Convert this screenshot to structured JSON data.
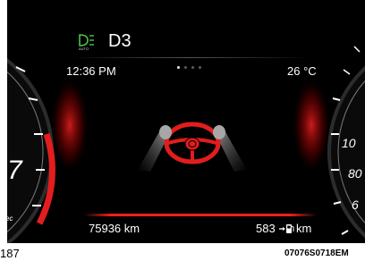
{
  "status": {
    "gear": "D3",
    "auto_label": "AUTO"
  },
  "info_bar": {
    "time": "12:36 PM",
    "outside_temp": "26 °C",
    "active_page_index": 0,
    "page_count": 4
  },
  "indicator": {
    "icon": "auto-headlight-icon",
    "color": "#4dc34d"
  },
  "center": {
    "icon": "steering-wheel-hands-icon",
    "wheel_color": "#e31d1d"
  },
  "trip": {
    "odometer": "75936 km",
    "range_value": "583",
    "range_unit": "km",
    "range_icon": "fuel-pump-icon"
  },
  "gauges": {
    "left_visible_number": "7",
    "right_visible_numbers": [
      "10",
      "80",
      "6"
    ],
    "left_small_text": "ec"
  },
  "caption": {
    "page_number": "187",
    "image_code": "07076S0718EM"
  },
  "colors": {
    "accent_red": "#e31d1d",
    "text": "#ffffff",
    "screen_bg": "#000000",
    "auto_green": "#4dc34d"
  }
}
